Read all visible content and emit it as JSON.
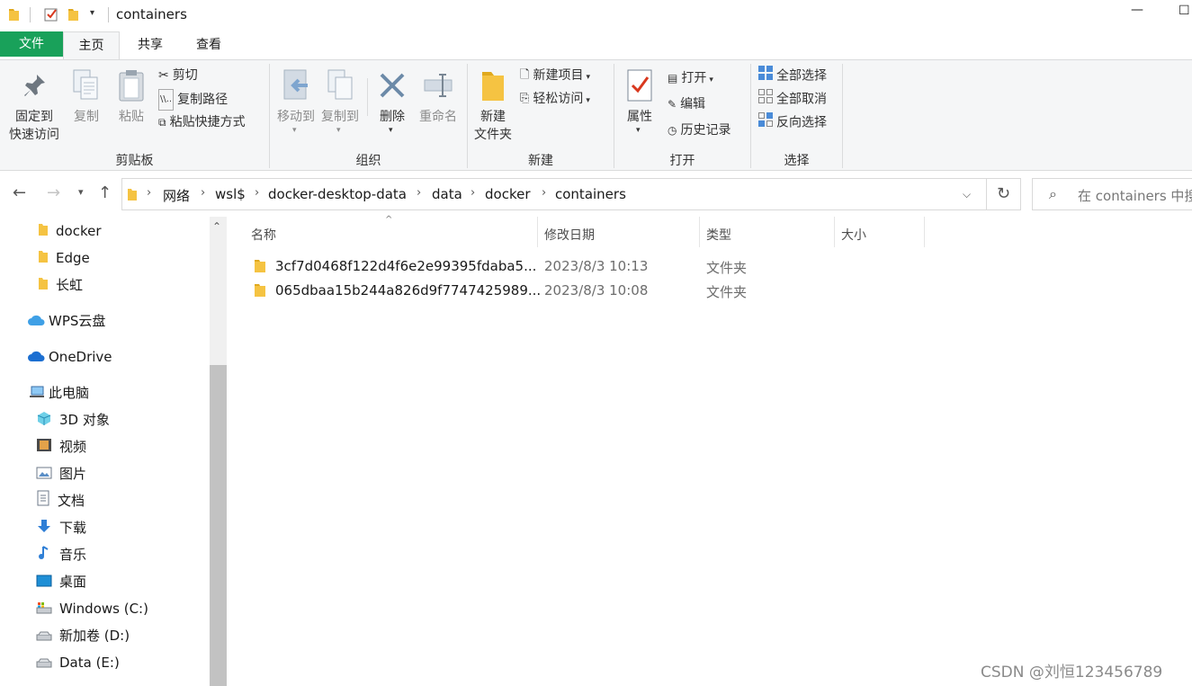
{
  "window": {
    "title": "containers",
    "minimize": "—",
    "maximize": "☐"
  },
  "ribbon_tabs": {
    "file": "文件",
    "home": "主页",
    "share": "共享",
    "view": "查看"
  },
  "ribbon": {
    "clipboard": {
      "pin_line1": "固定到",
      "pin_line2": "快速访问",
      "copy": "复制",
      "paste": "粘贴",
      "cut": "剪切",
      "copy_path": "复制路径",
      "paste_shortcut": "粘贴快捷方式",
      "group_label": "剪贴板"
    },
    "organize": {
      "move_to": "移动到",
      "copy_to": "复制到",
      "delete": "删除",
      "rename": "重命名",
      "group_label": "组织"
    },
    "new": {
      "new_folder_line1": "新建",
      "new_folder_line2": "文件夹",
      "new_item": "新建项目",
      "easy_access": "轻松访问",
      "group_label": "新建"
    },
    "open": {
      "properties": "属性",
      "open": "打开",
      "edit": "编辑",
      "history": "历史记录",
      "group_label": "打开"
    },
    "select": {
      "select_all": "全部选择",
      "select_none": "全部取消",
      "invert": "反向选择",
      "group_label": "选择"
    }
  },
  "breadcrumb": [
    "网络",
    "wsl$",
    "docker-desktop-data",
    "data",
    "docker",
    "containers"
  ],
  "search": {
    "placeholder": "在 containers 中搜"
  },
  "nav_pane": {
    "quick": [
      {
        "label": "docker"
      },
      {
        "label": "Edge"
      },
      {
        "label": "长虹"
      }
    ],
    "wps": "WPS云盘",
    "onedrive": "OneDrive",
    "this_pc": "此电脑",
    "pc_items": [
      {
        "label": "3D 对象",
        "icon": "3d-objects-icon"
      },
      {
        "label": "视频",
        "icon": "video-icon"
      },
      {
        "label": "图片",
        "icon": "pictures-icon"
      },
      {
        "label": "文档",
        "icon": "documents-icon"
      },
      {
        "label": "下载",
        "icon": "downloads-icon"
      },
      {
        "label": "音乐",
        "icon": "music-icon"
      },
      {
        "label": "桌面",
        "icon": "desktop-icon"
      },
      {
        "label": "Windows (C:)",
        "icon": "drive-c-icon"
      },
      {
        "label": "新加卷 (D:)",
        "icon": "drive-icon"
      },
      {
        "label": "Data (E:)",
        "icon": "drive-icon"
      }
    ]
  },
  "columns": {
    "name": "名称",
    "modified": "修改日期",
    "type": "类型",
    "size": "大小"
  },
  "files": [
    {
      "name": "3cf7d0468f122d4f6e2e99395fdaba5...",
      "modified": "2023/8/3 10:13",
      "type": "文件夹"
    },
    {
      "name": "065dbaa15b244a826d9f7747425989...",
      "modified": "2023/8/3 10:08",
      "type": "文件夹"
    }
  ],
  "watermark": "CSDN @刘恒123456789",
  "colors": {
    "file_tab": "#19a15a",
    "folder": "#f5c342",
    "ribbon_bg": "#f5f6f7"
  }
}
